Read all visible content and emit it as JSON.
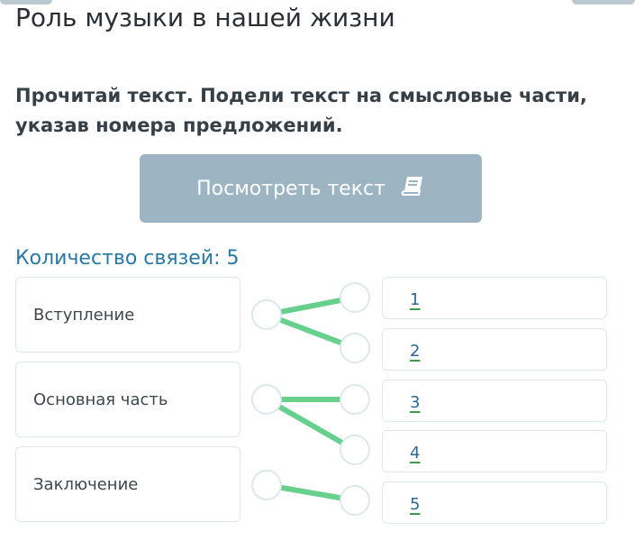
{
  "page": {
    "title": "Роль музыки в нашей жизни",
    "instruction": "Прочитай текст. Подели текст на смысловые части, указав номера предложений.",
    "view_button_label": "Посмотреть текст",
    "view_button_icon": "book-icon",
    "links_count_text": "Количество связей: 5"
  },
  "left_items": [
    "Вступление",
    "Основная часть",
    "Заключение"
  ],
  "right_items": [
    "1",
    "2",
    "3",
    "4",
    "5"
  ],
  "connections": [
    {
      "from": "Вступление",
      "to": "1"
    },
    {
      "from": "Вступление",
      "to": "2"
    },
    {
      "from": "Основная часть",
      "to": "3"
    },
    {
      "from": "Основная часть",
      "to": "4"
    },
    {
      "from": "Заключение",
      "to": "5"
    }
  ],
  "colors": {
    "link": "#66d08c",
    "button": "#9db4c2",
    "count_text": "#2a78a5",
    "underline": "#3e9a4b"
  }
}
